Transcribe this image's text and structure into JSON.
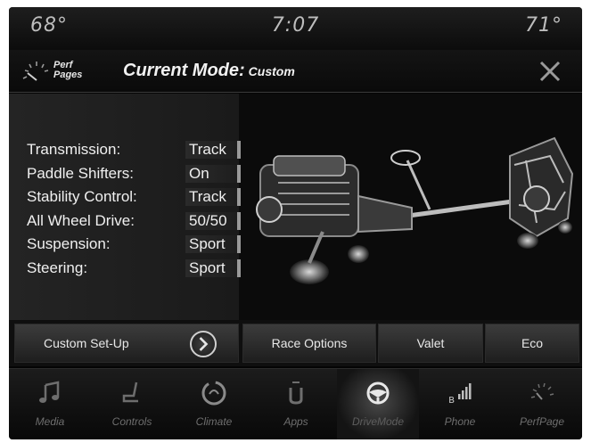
{
  "status_bar": {
    "temp_left": "68°",
    "time": "7:07",
    "temp_right": "71°"
  },
  "header": {
    "app_name_line1": "Perf",
    "app_name_line2": "Pages",
    "mode_label": "Current Mode:",
    "mode_value": "Custom",
    "close_icon": "close-x-icon"
  },
  "settings": [
    {
      "name": "Transmission:",
      "value": "Track"
    },
    {
      "name": "Paddle Shifters:",
      "value": "On"
    },
    {
      "name": "Stability Control:",
      "value": "Track"
    },
    {
      "name": "All Wheel Drive:",
      "value": "50/50"
    },
    {
      "name": "Suspension:",
      "value": "Sport"
    },
    {
      "name": "Steering:",
      "value": "Sport"
    }
  ],
  "buttons": {
    "custom_setup": "Custom Set-Up",
    "race_options": "Race Options",
    "valet": "Valet",
    "eco": "Eco"
  },
  "nav": [
    {
      "label": "Media",
      "icon": "music-note-icon"
    },
    {
      "label": "Controls",
      "icon": "seat-icon"
    },
    {
      "label": "Climate",
      "icon": "climate-icon"
    },
    {
      "label": "Apps",
      "icon": "apps-icon"
    },
    {
      "label": "DriveMode",
      "icon": "steering-wheel-icon",
      "active": true
    },
    {
      "label": "Phone",
      "icon": "phone-signal-icon"
    },
    {
      "label": "PerfPage",
      "icon": "gauge-icon"
    }
  ],
  "colors": {
    "background": "#050505",
    "text": "#f0f0f0",
    "nav_label": "#6e6e6e"
  }
}
